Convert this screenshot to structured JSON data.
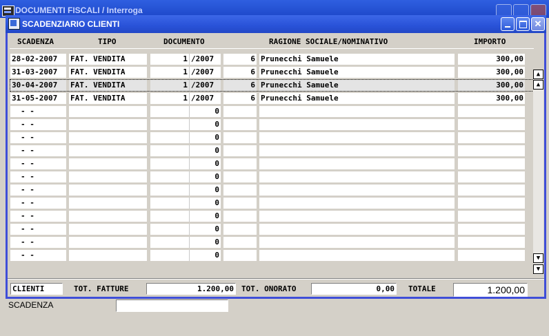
{
  "parent_window": {
    "title": "DOCUMENTI FISCALI / Interroga"
  },
  "dialog": {
    "title": "SCADENZIARIO CLIENTI"
  },
  "columns": {
    "scadenza": "SCADENZA",
    "tipo": "TIPO",
    "documento": "DOCUMENTO",
    "ragione": "RAGIONE SOCIALE/NOMINATIVO",
    "importo": "IMPORTO"
  },
  "rows": [
    {
      "scadenza": "28-02-2007",
      "tipo": "FAT. VENDITA",
      "numero": "1",
      "anno": "/2007",
      "protocollo": "6",
      "nome": "Prunecchi Samuele",
      "importo": "300,00"
    },
    {
      "scadenza": "31-03-2007",
      "tipo": "FAT. VENDITA",
      "numero": "1",
      "anno": "/2007",
      "protocollo": "6",
      "nome": "Prunecchi Samuele",
      "importo": "300,00"
    },
    {
      "scadenza": "30-04-2007",
      "tipo": "FAT. VENDITA",
      "numero": "1",
      "anno": "/2007",
      "protocollo": "6",
      "nome": "Prunecchi Samuele",
      "importo": "300,00"
    },
    {
      "scadenza": "31-05-2007",
      "tipo": "FAT. VENDITA",
      "numero": "1",
      "anno": "/2007",
      "protocollo": "6",
      "nome": "Prunecchi Samuele",
      "importo": "300,00"
    }
  ],
  "empty_row": {
    "scadenza": "-  -",
    "anno": "0"
  },
  "selected_row_index": 2,
  "empty_row_count": 12,
  "footer": {
    "client_value": "CLIENTI",
    "tot_fatture_label": "TOT. FATTURE",
    "tot_fatture_value": "1.200,00",
    "tot_onorato_label": "TOT. ONORATO",
    "tot_onorato_value": "0,00",
    "totale_label": "TOTALE",
    "totale_value": "1.200,00",
    "scadenza_label": "SCADENZA",
    "scadenza_value": ""
  },
  "icons": {
    "scroll_top": "scroll-top-icon",
    "scroll_up": "scroll-up-icon",
    "scroll_down": "scroll-down-icon",
    "scroll_bottom": "scroll-bottom-icon"
  },
  "colors": {
    "titlebar": "#2952d8",
    "window_bg": "#d4d0c8"
  }
}
